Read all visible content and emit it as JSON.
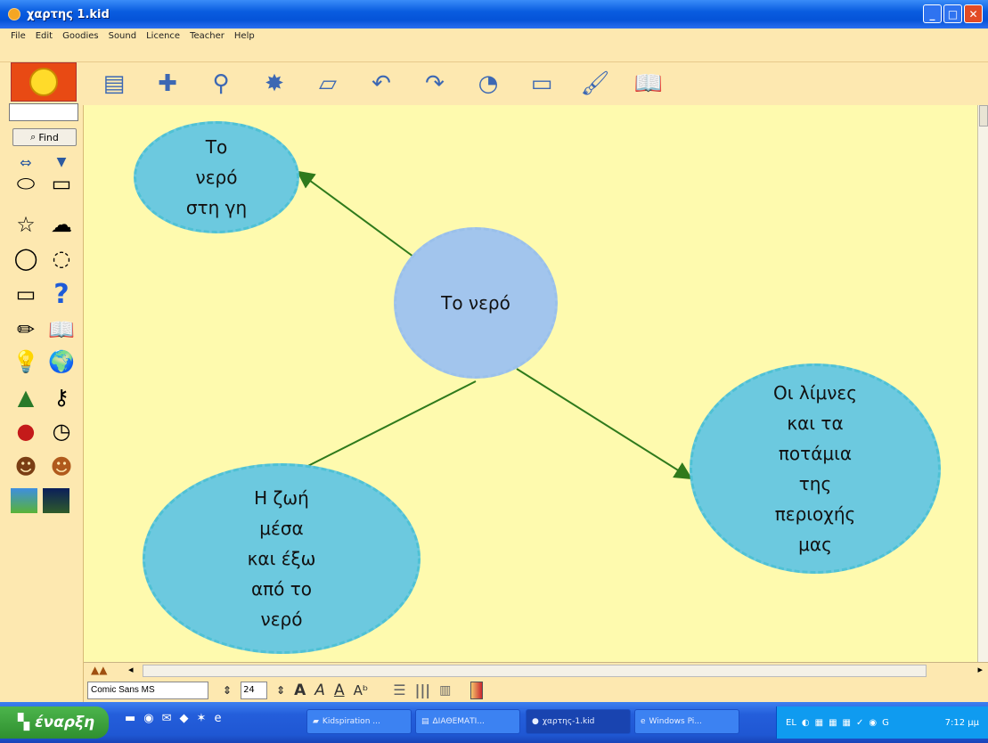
{
  "window": {
    "title": "χαρτης 1.kid"
  },
  "menu": [
    "File",
    "Edit",
    "Goodies",
    "Sound",
    "Licence",
    "Teacher",
    "Help"
  ],
  "palette": {
    "find_label": "Find"
  },
  "diagram": {
    "center": "Το νερό",
    "top_left": [
      "Το",
      "νερό",
      "στη γη"
    ],
    "bottom_left": [
      "Η ζωή",
      "μέσα",
      "και έξω",
      "από το",
      "νερό"
    ],
    "right": [
      "Οι λίμνες",
      "και τα",
      "ποτάμια",
      "της",
      "περιοχής",
      "μας"
    ]
  },
  "fontbar": {
    "font_name": "Comic Sans MS",
    "font_size": "24"
  },
  "taskbar": {
    "start_label": "έναρξη",
    "tasks": [
      "Kidspiration ...",
      "ΔΙΑΘΕΜΑΤΙ...",
      "χαρτης-1.kid",
      "Windows Pi..."
    ],
    "language": "EL",
    "clock": "7:12 μμ"
  },
  "colors": {
    "canvas": "#fefaae",
    "node_sub": "#6cc9df",
    "node_main": "#a2c5ed",
    "link": "#3a7a1d"
  }
}
